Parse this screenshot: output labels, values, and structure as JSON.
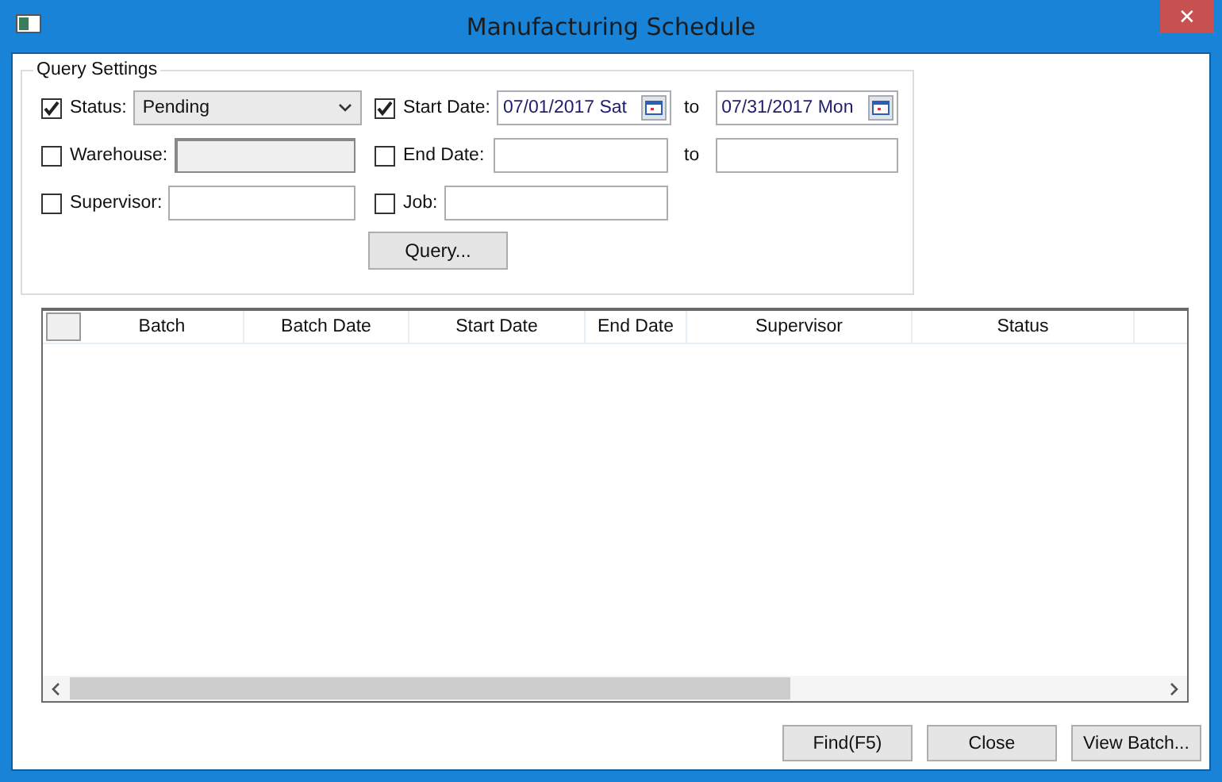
{
  "window": {
    "title": "Manufacturing Schedule",
    "close_glyph": "✕"
  },
  "query_settings": {
    "title": "Query Settings",
    "rows": [
      [
        {
          "kind": "select",
          "label": "Status:",
          "checked": true,
          "value": "Pending"
        },
        {
          "kind": "date_range",
          "label": "Start Date:",
          "checked": true,
          "from": "07/01/2017 Sat",
          "separator": "to",
          "to": "07/31/2017 Mon"
        }
      ],
      [
        {
          "kind": "text",
          "label": "Warehouse:",
          "checked": false,
          "disabled": true
        },
        {
          "kind": "date_range",
          "label": "End Date:",
          "checked": false,
          "separator": "to"
        }
      ],
      [
        {
          "kind": "text",
          "label": "Supervisor:",
          "checked": false,
          "disabled": false
        },
        {
          "kind": "text",
          "label": "Job:",
          "checked": false,
          "disabled": false
        }
      ]
    ],
    "query_button": "Query..."
  },
  "table": {
    "columns": [
      {
        "label": "Batch"
      },
      {
        "label": "Batch Date"
      },
      {
        "label": "Start Date"
      },
      {
        "label": "End Date"
      },
      {
        "label": "Supervisor"
      },
      {
        "label": "Status"
      }
    ]
  },
  "buttons": [
    "Find(F5)",
    "Close",
    "View Batch..."
  ]
}
